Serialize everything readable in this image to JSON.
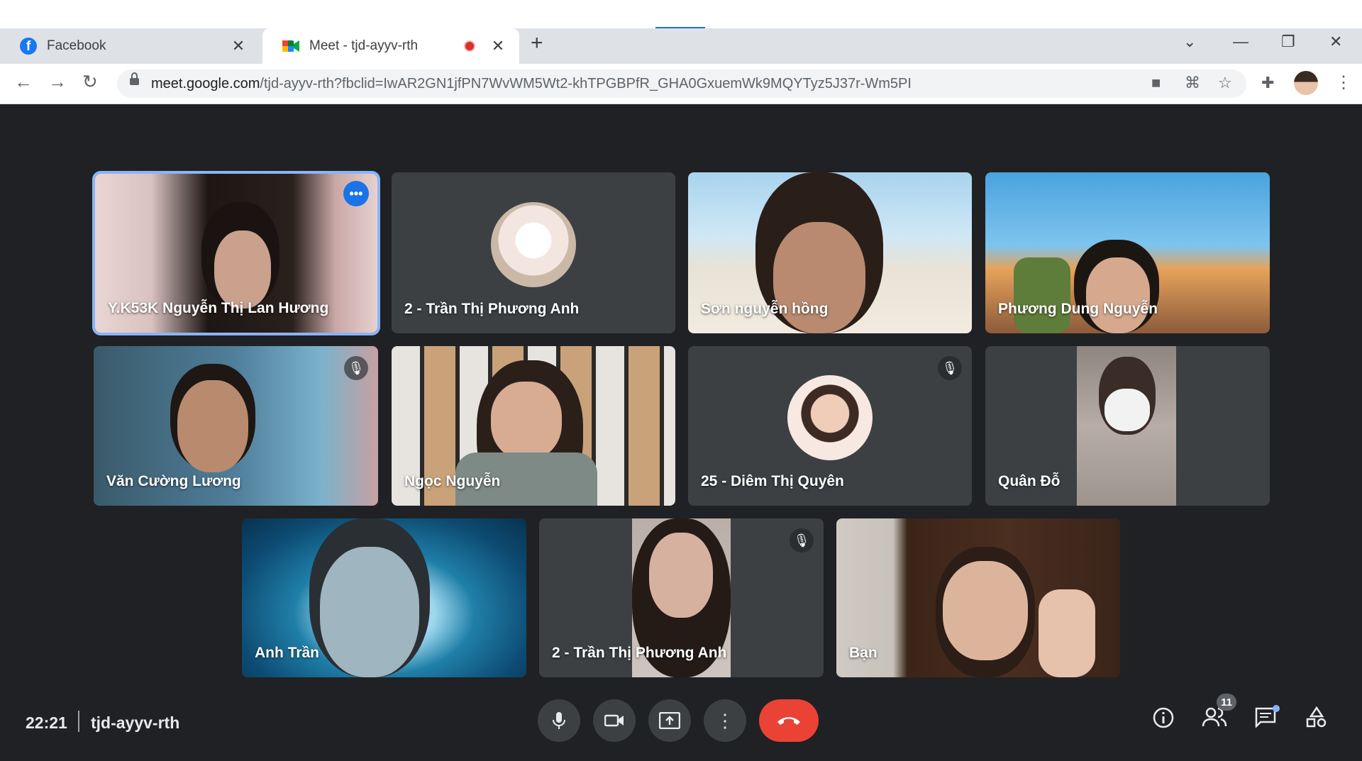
{
  "browser": {
    "tabs": [
      {
        "title": "Facebook",
        "icon": "facebook-icon"
      },
      {
        "title": "Meet - tjd-ayyv-rth",
        "icon": "google-meet-icon",
        "recording": true
      }
    ],
    "url_host": "meet.google.com",
    "url_path": "/tjd-ayyv-rth?fbclid=IwAR2GN1jfPN7WvWM5Wt2-khTPGBPfR_GHA0GxuemWk9MQYTyz5J37r-Wm5PI"
  },
  "participants": [
    {
      "name": "Y.K53K Nguyễn Thị Lan Hương"
    },
    {
      "name": "2 - Trần Thị Phương Anh"
    },
    {
      "name": "Sơn nguyễn hồng"
    },
    {
      "name": "Phương Dung Nguyễn"
    },
    {
      "name": "Văn Cường Lương"
    },
    {
      "name": "Ngọc Nguyễn"
    },
    {
      "name": "25 - Diêm Thị Quyên"
    },
    {
      "name": "Quân Đỗ"
    },
    {
      "name": "Anh Trần"
    },
    {
      "name": "2 - Trần Thị Phương Anh"
    },
    {
      "name": "Bạn"
    }
  ],
  "meeting": {
    "time": "22:21",
    "code": "tjd-ayyv-rth",
    "participant_count": "11"
  },
  "colors": {
    "background": "#202124",
    "tile": "#3c4043",
    "hangup": "#ea4335",
    "active_border": "#8ab4f8",
    "accent": "#1a73e8"
  }
}
